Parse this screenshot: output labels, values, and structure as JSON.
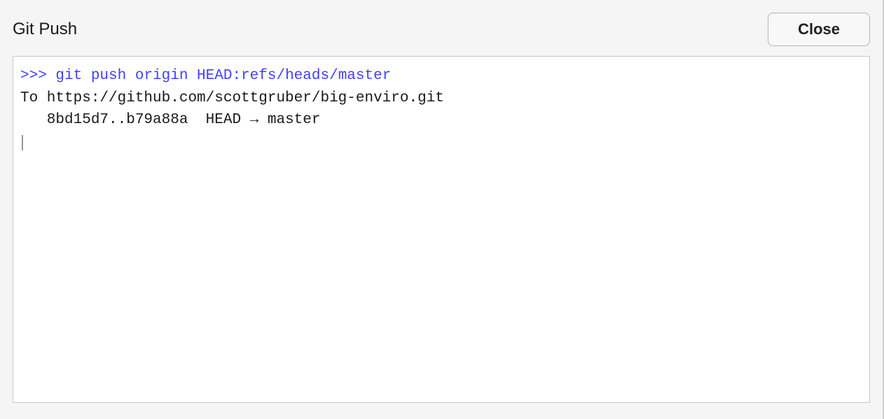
{
  "dialog": {
    "title": "Git Push",
    "close_label": "Close"
  },
  "terminal": {
    "prompt_prefix": ">>> ",
    "command": "git push origin HEAD:refs/heads/master",
    "output_lines": [
      "To https://github.com/scottgruber/big-enviro.git",
      "   8bd15d7..b79a88a  HEAD → master"
    ]
  }
}
